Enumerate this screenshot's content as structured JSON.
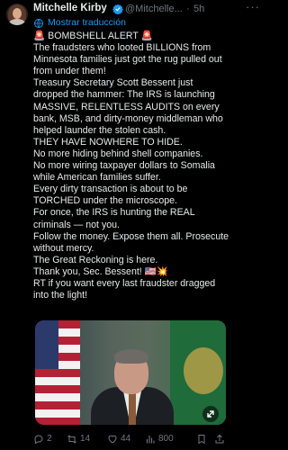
{
  "tweet": {
    "author_name": "Mitchelle Kirby",
    "handle": "@Mitchelle...",
    "separator": "·",
    "time": "5h",
    "more_label": "···",
    "translate_label": "Mostrar traducción",
    "body_lines": [
      "🚨 BOMBSHELL ALERT 🚨",
      "The fraudsters who looted BILLIONS from",
      "Minnesota families just got the rug pulled out",
      "from under them!",
      "Treasury Secretary Scott Bessent just",
      "dropped the hammer: The IRS is launching",
      "MASSIVE, RELENTLESS AUDITS on every",
      "bank, MSB, and dirty-money middleman who",
      "helped launder the stolen cash.",
      "THEY HAVE NOWHERE TO HIDE.",
      "No more hiding behind shell companies.",
      "No more wiring taxpayer dollars to Somalia",
      "while American families suffer.",
      "Every dirty transaction is about to be",
      "TORCHED under the microscope.",
      "For once, the IRS is hunting the REAL",
      "criminals — not you.",
      "Follow the money. Expose them all. Prosecute",
      "without mercy.",
      "The Great Reckoning is here.",
      "Thank you, Sec. Bessent! 🇺🇸💥",
      "RT if you want every last fraudster dragged",
      "into the light!"
    ],
    "media": {
      "type": "video",
      "fullscreen_icon": "expand-icon"
    },
    "actions": {
      "replies": "2",
      "retweets": "14",
      "likes": "44",
      "views": "800"
    },
    "colors": {
      "background": "#000000",
      "text": "#e7e9ea",
      "muted": "#71767b",
      "accent": "#1d9bf0"
    },
    "icons": {
      "verified": "verified-badge-icon",
      "translate": "globe-icon",
      "reply": "reply-icon",
      "retweet": "retweet-icon",
      "like": "heart-icon",
      "views": "views-chart-icon",
      "bookmark": "bookmark-icon",
      "share": "share-icon"
    }
  }
}
